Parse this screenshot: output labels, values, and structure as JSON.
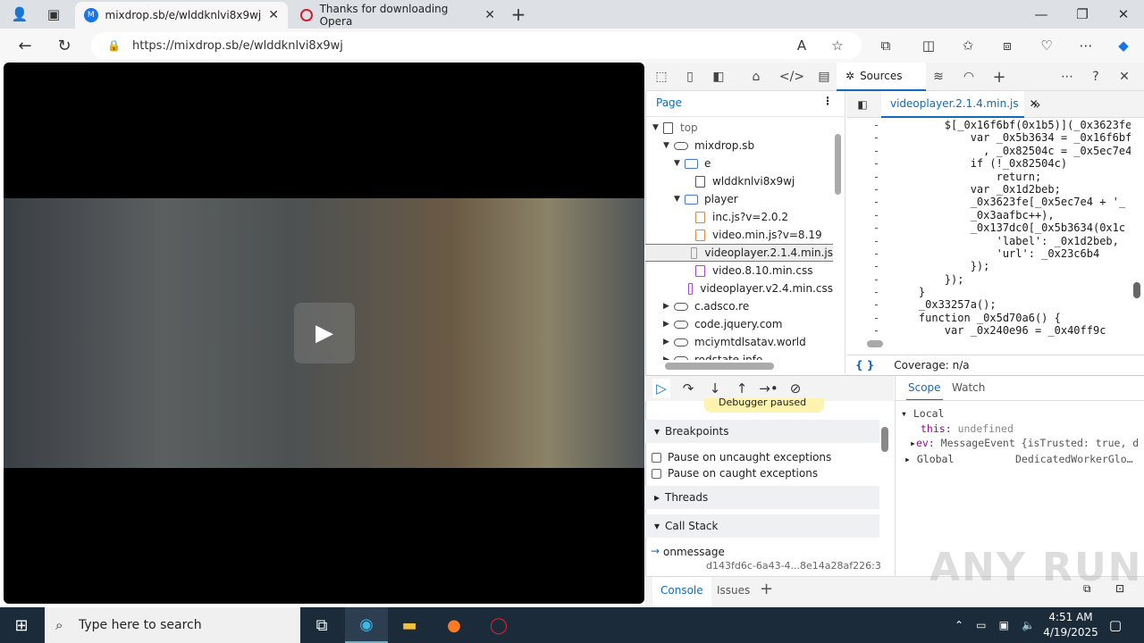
{
  "browser": {
    "tabs": [
      {
        "label": "mixdrop.sb/e/wlddknlvi8x9wj",
        "active": true
      },
      {
        "label": "Thanks for downloading Opera",
        "active": false
      }
    ],
    "url": "https://mixdrop.sb/e/wlddknlvi8x9wj"
  },
  "video": {
    "play_icon": "play-icon"
  },
  "devtools": {
    "active_tool": "Sources",
    "navigator_tab": "Page",
    "file_tab": "videoplayer.2.1.4.min.js",
    "tree": [
      {
        "label": "top",
        "type": "frame",
        "depth": 0,
        "open": true
      },
      {
        "label": "mixdrop.sb",
        "type": "domain",
        "depth": 1,
        "open": true
      },
      {
        "label": "e",
        "type": "folder",
        "depth": 2,
        "open": true
      },
      {
        "label": "wlddknlvi8x9wj",
        "type": "doc",
        "depth": 3
      },
      {
        "label": "player",
        "type": "folder",
        "depth": 2,
        "open": true
      },
      {
        "label": "inc.js?v=2.0.2",
        "type": "js",
        "depth": 3
      },
      {
        "label": "video.min.js?v=8.19",
        "type": "js",
        "depth": 3
      },
      {
        "label": "videoplayer.2.1.4.min.js",
        "type": "js",
        "depth": 3,
        "selected": true
      },
      {
        "label": "video.8.10.min.css",
        "type": "css",
        "depth": 3
      },
      {
        "label": "videoplayer.v2.4.min.css",
        "type": "css",
        "depth": 3
      },
      {
        "label": "c.adsco.re",
        "type": "domain",
        "depth": 1
      },
      {
        "label": "code.jquery.com",
        "type": "domain",
        "depth": 1
      },
      {
        "label": "mciymtdlsatav.world",
        "type": "domain",
        "depth": 1
      },
      {
        "label": "rodstate.info",
        "type": "domain",
        "depth": 1
      }
    ],
    "code_lines": [
      "        $[_0x16f6bf(0x1b5)](_0x3623fe",
      "            var _0x5b3634 = _0x16f6bf",
      "              , _0x82504c = _0x5ec7e4",
      "            if (!_0x82504c)",
      "                return;",
      "            var _0x1d2beb;",
      "            _0x3623fe[_0x5ec7e4 + '_",
      "            _0x3aafbc++),",
      "            _0x137dc0[_0x5b3634(0x1c",
      "                'label': _0x1d2beb,",
      "                'url': _0x23c6b4",
      "            });",
      "        });",
      "    }",
      "    _0x33257a();",
      "    function _0x5d70a6() {",
      "        var _0x240e96 = _0x40ff9c"
    ],
    "coverage": "Coverage: n/a",
    "paused_banner": "Debugger paused",
    "breakpoints_label": "Breakpoints",
    "pause_uncaught": "Pause on uncaught exceptions",
    "pause_caught": "Pause on caught exceptions",
    "threads_label": "Threads",
    "callstack_label": "Call Stack",
    "callstack": {
      "fn": "onmessage",
      "loc": "d143fd6c-6a43-4...8e14a28af226:3"
    },
    "scope_tabs": [
      "Scope",
      "Watch"
    ],
    "scope": {
      "local": "Local",
      "this_key": "this:",
      "this_val": "undefined",
      "ev_key": "ev:",
      "ev_val": "MessageEvent {isTrusted: true, d",
      "global": "Global",
      "global_val": "DedicatedWorkerGlo…"
    },
    "drawer_tabs": [
      "Console",
      "Issues"
    ]
  },
  "taskbar": {
    "search_placeholder": "Type here to search",
    "time": "4:51 AM",
    "date": "4/19/2025"
  },
  "watermark": "ANY RUN"
}
